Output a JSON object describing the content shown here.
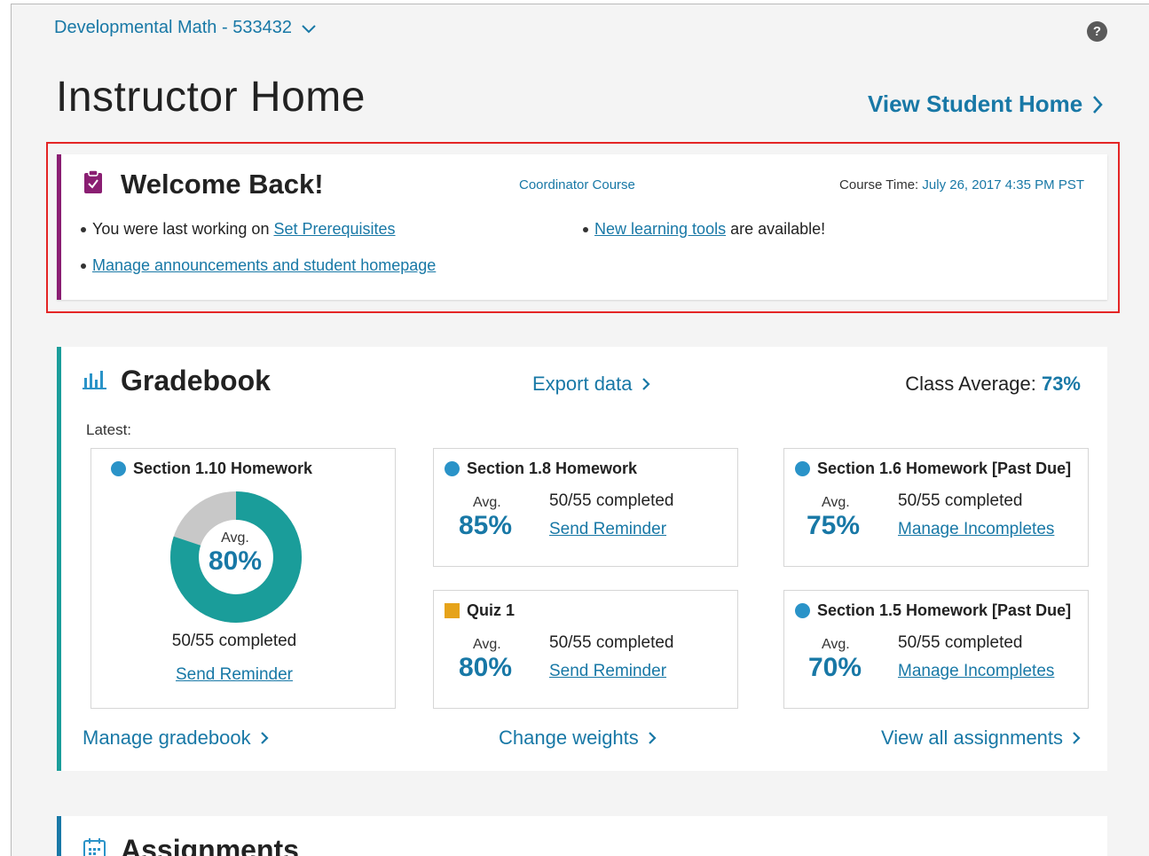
{
  "header": {
    "course_name": "Developmental Math - 533432",
    "help_label": "?",
    "page_title": "Instructor Home",
    "view_student_home": "View Student Home"
  },
  "welcome": {
    "title": "Welcome Back!",
    "coordinator_course": "Coordinator Course",
    "course_time_label": "Course Time:",
    "course_time_value": "July 26, 2017 4:35 PM PST",
    "last_working_prefix": "You were last working on",
    "last_working_link": "Set Prerequisites",
    "manage_announcements": "Manage announcements and student homepage",
    "new_tools_link": "New learning tools",
    "new_tools_suffix": "are available!"
  },
  "gradebook": {
    "title": "Gradebook",
    "export": "Export data",
    "class_average_label": "Class Average:",
    "class_average_value": "73%",
    "latest_label": "Latest:",
    "featured": {
      "title": "Section 1.10 Homework",
      "avg_label": "Avg.",
      "avg_value": "80%",
      "completed": "50/55 completed",
      "action": "Send Reminder",
      "donut_fraction": 0.8
    },
    "tiles": [
      {
        "title": "Section 1.8 Homework",
        "marker": "dot",
        "avg_label": "Avg.",
        "avg_value": "85%",
        "completed": "50/55 completed",
        "action": "Send Reminder"
      },
      {
        "title": "Section 1.6 Homework [Past Due]",
        "marker": "dot",
        "avg_label": "Avg.",
        "avg_value": "75%",
        "completed": "50/55 completed",
        "action": "Manage Incompletes"
      },
      {
        "title": "Quiz 1",
        "marker": "square",
        "avg_label": "Avg.",
        "avg_value": "80%",
        "completed": "50/55 completed",
        "action": "Send Reminder"
      },
      {
        "title": "Section 1.5 Homework [Past Due]",
        "marker": "dot",
        "avg_label": "Avg.",
        "avg_value": "70%",
        "completed": "50/55 completed",
        "action": "Manage Incompletes"
      }
    ],
    "footer": {
      "manage": "Manage gradebook",
      "weights": "Change weights",
      "view_all": "View all assignments"
    }
  },
  "assignments": {
    "title": "Assignments"
  },
  "colors": {
    "accent": "#1878a6",
    "welcome_bar": "#8a1e72",
    "gradebook_bar": "#1a9d9a",
    "donut_fill": "#1a9d9a",
    "donut_rest": "#c8c8c8",
    "quiz_marker": "#e6a31a",
    "homework_marker": "#2a93c8",
    "highlight_box": "#e42525"
  }
}
